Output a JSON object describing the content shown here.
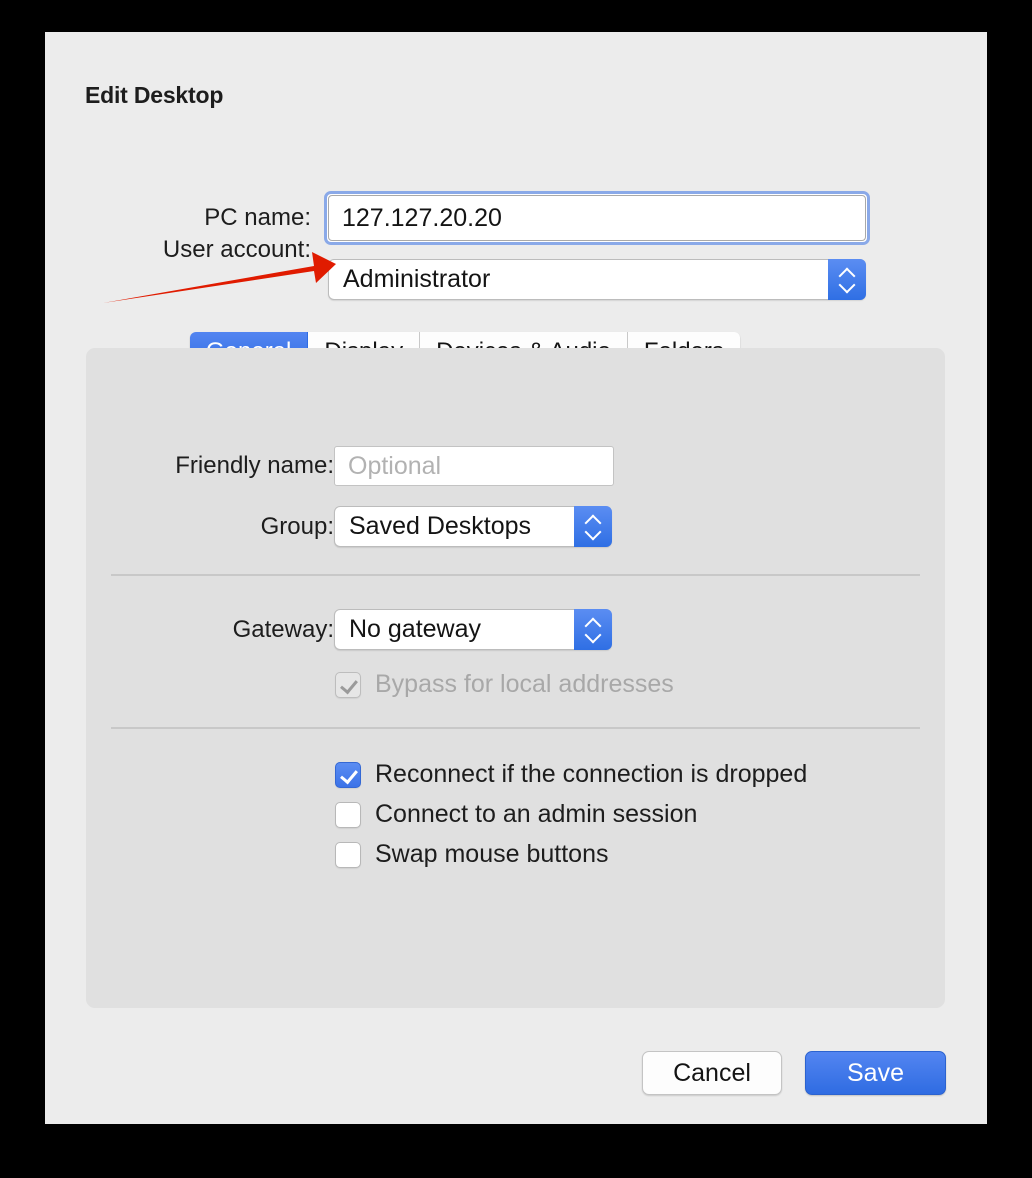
{
  "dialog": {
    "title": "Edit Desktop",
    "top_fields": [
      {
        "label": "PC name:",
        "value": "127.127.20.20",
        "control": "text-field",
        "focused": true
      },
      {
        "label": "User account:",
        "value": "Administrator",
        "control": "popup-button",
        "focused": false
      }
    ],
    "tabs": [
      {
        "label": "General",
        "active": true
      },
      {
        "label": "Display",
        "active": false
      },
      {
        "label": "Devices & Audio",
        "active": false
      },
      {
        "label": "Folders",
        "active": false
      }
    ],
    "general_tab": {
      "friendly_name": {
        "label": "Friendly name:",
        "value": "",
        "placeholder": "Optional"
      },
      "group": {
        "label": "Group:",
        "value": "Saved Desktops"
      },
      "gateway": {
        "label": "Gateway:",
        "value": "No gateway"
      },
      "bypass_checkbox": {
        "label": "Bypass for local addresses",
        "checked": true,
        "enabled": false
      },
      "options": [
        {
          "label": "Reconnect if the connection is dropped",
          "checked": true
        },
        {
          "label": "Connect to an admin session",
          "checked": false
        },
        {
          "label": "Swap mouse buttons",
          "checked": false
        }
      ]
    },
    "buttons": {
      "cancel": "Cancel",
      "save": "Save"
    }
  },
  "annotation": {
    "type": "arrow",
    "color": "#e01b00",
    "points_to": "User account:"
  },
  "colors": {
    "accent_blue": "#3b72e8",
    "dialog_background": "#ececec",
    "panel_background": "#e0e0e0",
    "focus_ring": "#8aa9e8",
    "annotation_red": "#e01b00"
  }
}
